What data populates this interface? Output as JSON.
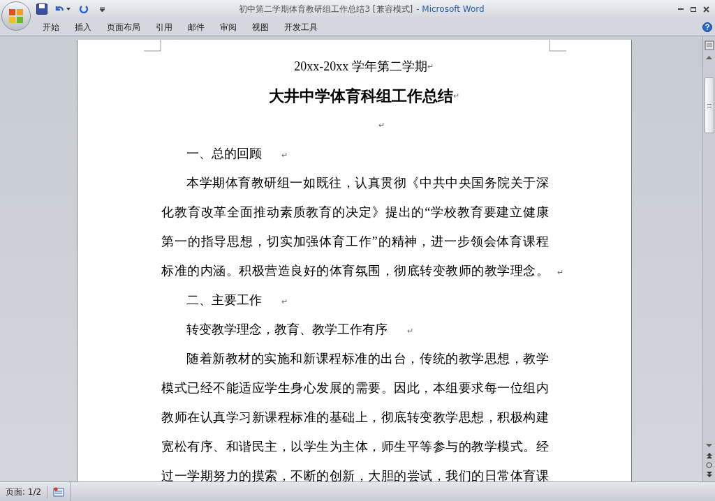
{
  "window": {
    "title": "初中第二学期体育教研组工作总结3 [兼容模式]",
    "app_name": "- Microsoft Word"
  },
  "ribbon_tabs": [
    {
      "label": "开始",
      "selected": false
    },
    {
      "label": "插入",
      "selected": false
    },
    {
      "label": "页面布局",
      "selected": false
    },
    {
      "label": "引用",
      "selected": false
    },
    {
      "label": "邮件",
      "selected": false
    },
    {
      "label": "审阅",
      "selected": false
    },
    {
      "label": "视图",
      "selected": false
    },
    {
      "label": "开发工具",
      "selected": false
    }
  ],
  "document": {
    "paragraphs": [
      {
        "kind": "subtitle",
        "lines": [
          "20xx-20xx 学年第二学期"
        ],
        "mark": "↵"
      },
      {
        "kind": "title",
        "lines": [
          "大井中学体育科组工作总结"
        ],
        "mark": "↵"
      },
      {
        "kind": "empty",
        "mark": "↵"
      },
      {
        "kind": "heading",
        "lines": [
          "一、总的回顾"
        ],
        "mark": "↵"
      },
      {
        "kind": "body",
        "lines": [
          "本学期体育教研组一如既往，认真贯彻《中共中央国务院关于深",
          "化教育改革全面推动素质教育的决定》提出的“学校教育要建立健康",
          "第一的指导思想，切实加强体育工作”的精神，进一步领会体育课程",
          "标准的内涵。积极营造良好的体育氛围，彻底转变教师的教学理念。"
        ],
        "mark": "↵"
      },
      {
        "kind": "heading",
        "lines": [
          "二、主要工作"
        ],
        "mark": "↵"
      },
      {
        "kind": "heading",
        "lines": [
          "转变教学理念，教育、教学工作有序"
        ],
        "mark": "↵"
      },
      {
        "kind": "body",
        "lines": [
          "随着新教材的实施和新课程标准的出台，传统的教学思想，教学",
          "模式已经不能适应学生身心发展的需要。因此，本组要求每一位组内",
          "教师在认真学习新课程标准的基础上，彻底转变教学思想，积极构建",
          "宽松有序、和谐民主，以学生为主体，师生平等参与的教学模式。经",
          "过一学期努力的摸索，不断的创新，大胆的尝试，我们的日常体育课"
        ]
      }
    ]
  },
  "status_bar": {
    "page": "页面: 1/2"
  }
}
